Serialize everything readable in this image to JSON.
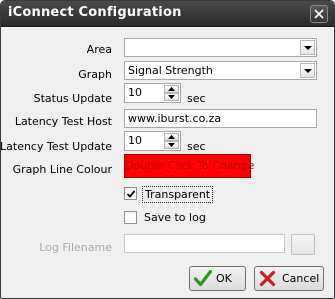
{
  "window": {
    "title": "iConnect Configuration"
  },
  "fields": {
    "area": {
      "label": "Area",
      "value": ""
    },
    "graph": {
      "label": "Graph",
      "value": "Signal Strength"
    },
    "status_update": {
      "label": "Status Update",
      "value": "10",
      "unit": "sec"
    },
    "latency_host": {
      "label": "Latency Test Host",
      "value": "www.iburst.co.za"
    },
    "latency_update": {
      "label": "Latency Test Update",
      "value": "10",
      "unit": "sec"
    },
    "graph_line_colour": {
      "label": "Graph Line Colour",
      "text": "Double Click To Change",
      "color": "#ff0000"
    },
    "transparent": {
      "label": "Transparent",
      "checked": true
    },
    "save_to_log": {
      "label": "Save to log",
      "checked": false
    },
    "log_filename": {
      "label": "Log Filename",
      "value": "",
      "enabled": false
    }
  },
  "buttons": {
    "ok": "OK",
    "cancel": "Cancel"
  },
  "icons": {
    "close": "close-icon",
    "dropdown": "chevron-down-icon",
    "ok": "green-check-icon",
    "cancel": "red-x-icon"
  }
}
